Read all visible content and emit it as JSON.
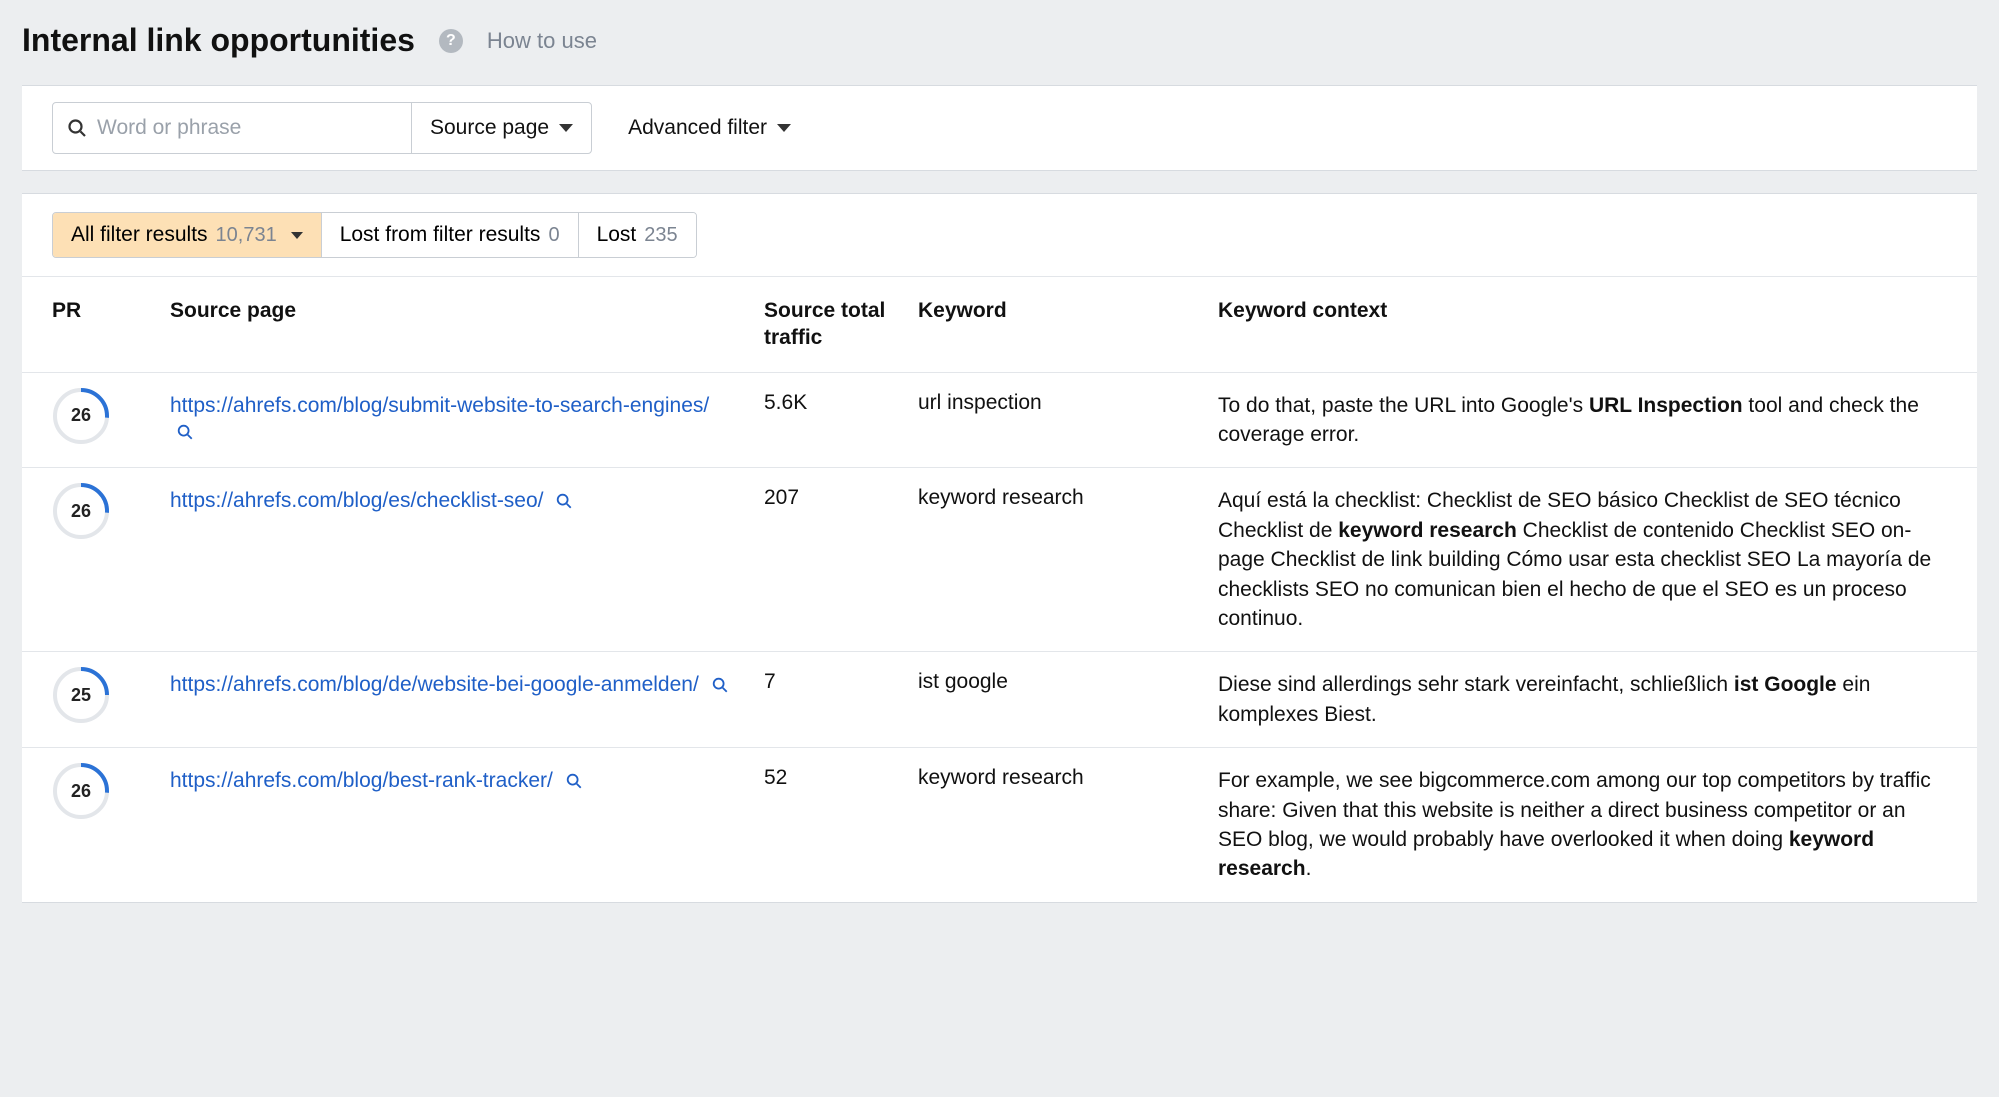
{
  "header": {
    "title": "Internal link opportunities",
    "how_to_use": "How to use"
  },
  "filters": {
    "search_placeholder": "Word or phrase",
    "mode_label": "Source page",
    "advanced_label": "Advanced filter"
  },
  "segments": {
    "all_label": "All filter results",
    "all_count": "10,731",
    "lost_filter_label": "Lost from filter results",
    "lost_filter_count": "0",
    "lost_label": "Lost",
    "lost_count": "235"
  },
  "columns": {
    "pr": "PR",
    "source": "Source page",
    "traffic": "Source total traffic",
    "keyword": "Keyword",
    "context": "Keyword context"
  },
  "rows": [
    {
      "pr": "26",
      "url": "https://ahrefs.com/blog/submit-website-to-search-engines/",
      "traffic": "5.6K",
      "keyword": "url inspection",
      "context_pre": "To do that, paste the URL into Google's ",
      "context_bold": "URL Inspection",
      "context_post": " tool and check the coverage error."
    },
    {
      "pr": "26",
      "url": "https://ahrefs.com/blog/es/checklist-seo/",
      "traffic": "207",
      "keyword": "keyword research",
      "context_pre": "Aquí está la checklist: Checklist de SEO básico Checklist de SEO técnico Checklist de ",
      "context_bold": "keyword research",
      "context_post": " Checklist de contenido Checklist SEO on-page Checklist de link building Cómo usar esta checklist SEO La mayoría de checklists SEO no comunican bien el hecho de que el SEO es un proceso continuo."
    },
    {
      "pr": "25",
      "url": "https://ahrefs.com/blog/de/website-bei-google-anmelden/",
      "traffic": "7",
      "keyword": "ist google",
      "context_pre": "Diese sind allerdings sehr stark vereinfacht, schließlich ",
      "context_bold": "ist Google",
      "context_post": " ein komplexes Biest."
    },
    {
      "pr": "26",
      "url": "https://ahrefs.com/blog/best-rank-tracker/",
      "traffic": "52",
      "keyword": "keyword research",
      "context_pre": "For example, we see bigcommerce.com among our top competitors by traffic share: Given that this website is neither a direct business competitor or an SEO blog, we would probably have overlooked it when doing ",
      "context_bold": "keyword research",
      "context_post": "."
    }
  ]
}
